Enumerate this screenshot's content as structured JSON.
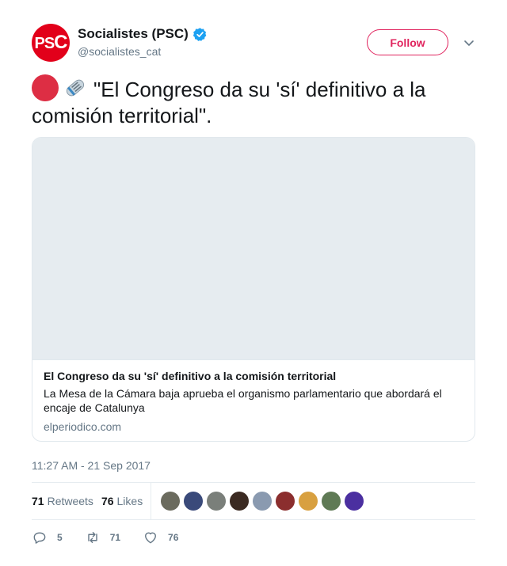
{
  "author": {
    "display_name": "Socialistes (PSC)",
    "handle": "@socialistes_cat",
    "avatar_text": "PS",
    "avatar_text_c": "C",
    "avatar_color": "#e2001a",
    "verified": true
  },
  "follow_label": "Follow",
  "tweet_text": "\"El Congreso da su 'sí' definitivo a la comisión territorial\".",
  "emojis": [
    "red-circle-icon",
    "rolled-newspaper-icon"
  ],
  "card": {
    "title": "El Congreso da su 'sí' definitivo a la comisión territorial",
    "description": "La Mesa de la Cámara baja aprueba el organismo parlamentario que abordará el encaje de Catalunya",
    "domain": "elperiodico.com"
  },
  "timestamp": "11:27 AM - 21 Sep 2017",
  "stats": {
    "retweets_count": "71",
    "retweets_label": "Retweets",
    "likes_count": "76",
    "likes_label": "Likes"
  },
  "liker_colors": [
    "#6b6b5e",
    "#3a4a7a",
    "#7a7f7a",
    "#3b2a22",
    "#8a9ab0",
    "#8b2e2e",
    "#d8a040",
    "#5f7a55",
    "#4b2fa0"
  ],
  "actions": {
    "replies": "5",
    "retweets": "71",
    "likes": "76"
  },
  "colors": {
    "accent": "#e0245e",
    "muted": "#657786",
    "verified": "#1da1f2"
  }
}
